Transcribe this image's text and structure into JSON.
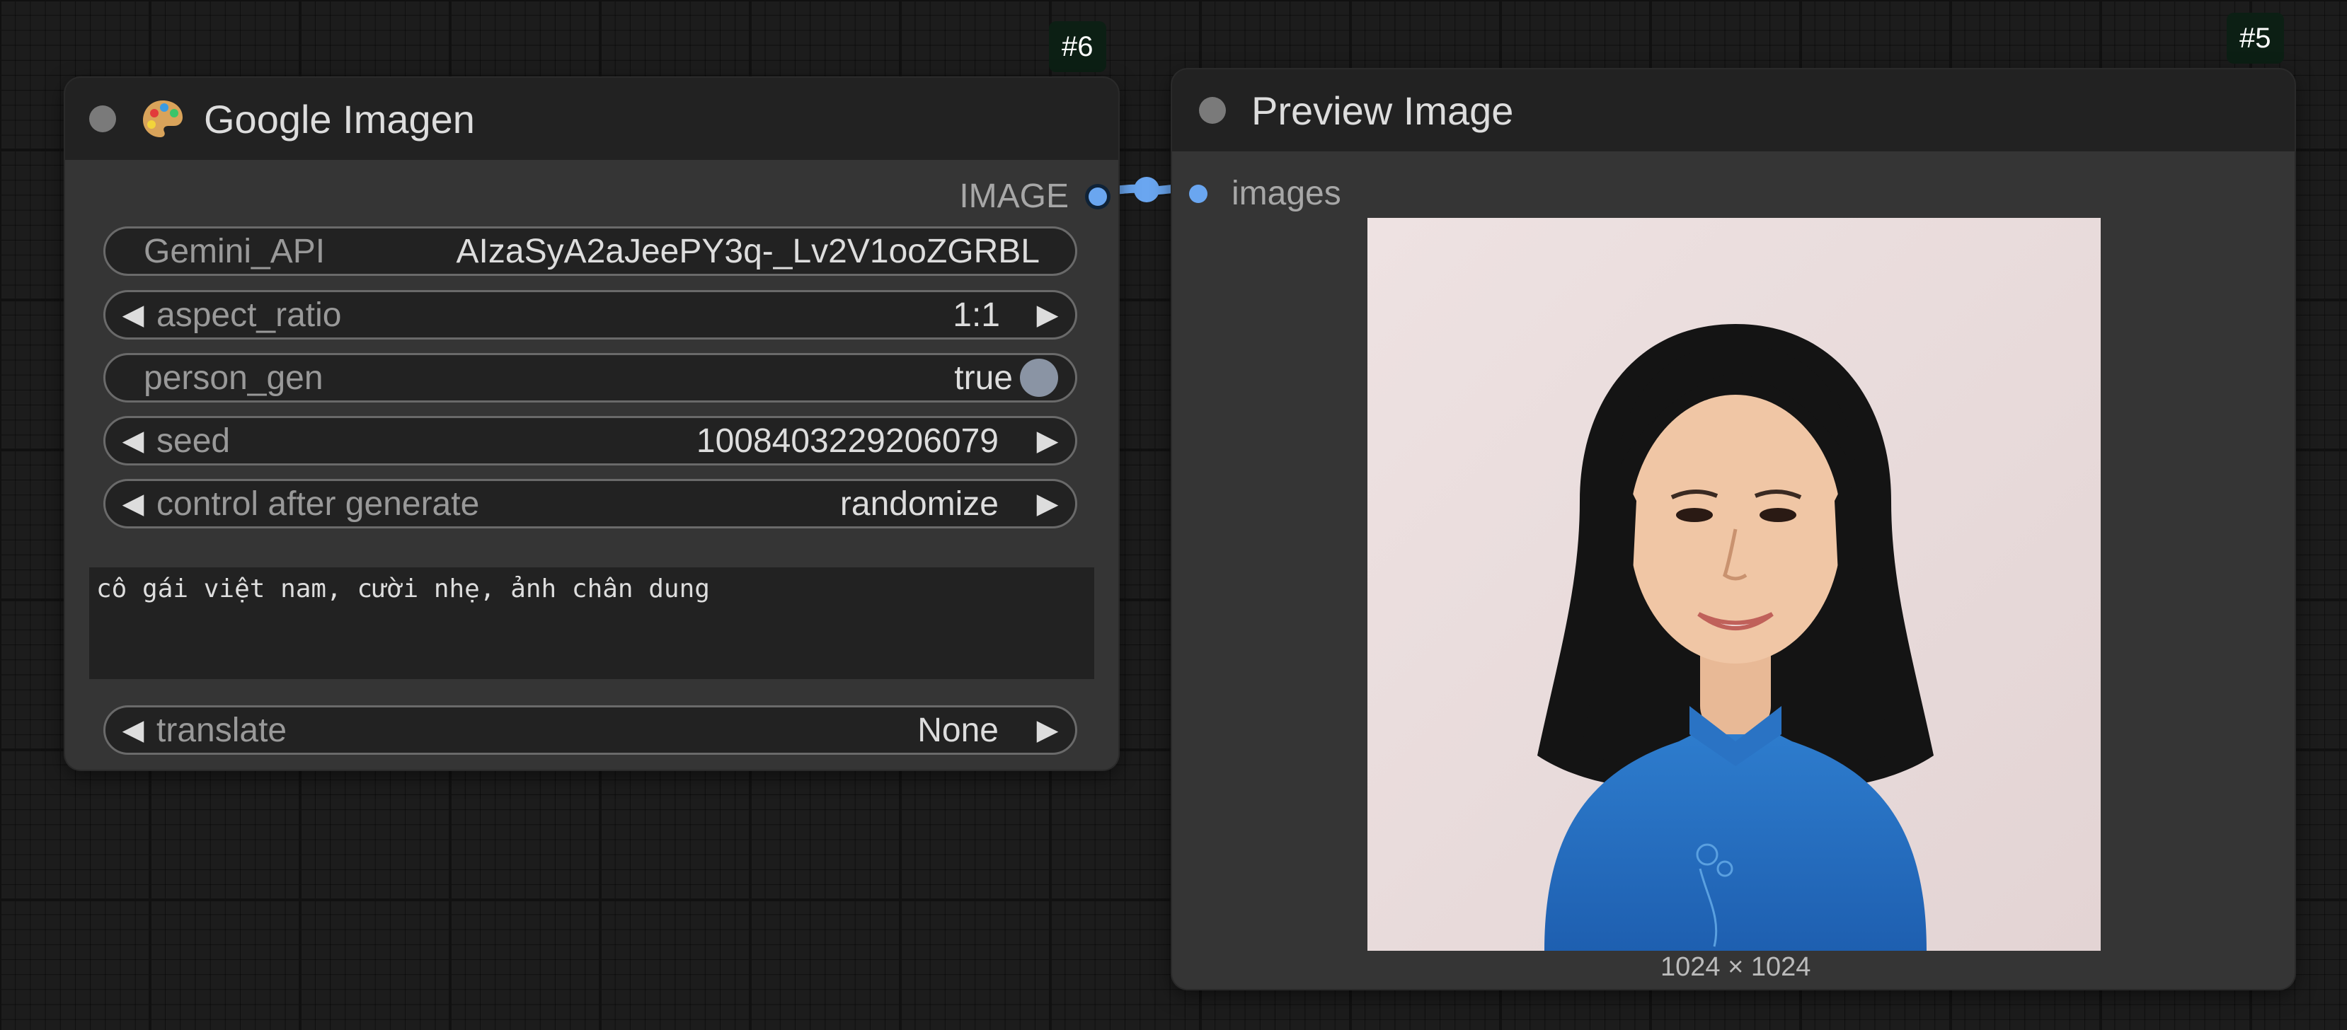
{
  "node_google": {
    "id_badge": "#6",
    "title": "Google Imagen",
    "icon": "palette-icon",
    "output_label": "IMAGE",
    "widgets": {
      "gemini_api": {
        "label": "Gemini_API",
        "value": "AIzaSyA2aJeePY3q-_Lv2V1ooZGRBL"
      },
      "aspect_ratio": {
        "label": "aspect_ratio",
        "value": "1:1"
      },
      "person_gen": {
        "label": "person_gen",
        "value": "true"
      },
      "seed": {
        "label": "seed",
        "value": "1008403229206079"
      },
      "control_after_generate": {
        "label": "control after generate",
        "value": "randomize"
      },
      "prompt": {
        "value": "cô gái việt nam, cười nhẹ, ảnh chân dung"
      },
      "translate": {
        "label": "translate",
        "value": "None"
      }
    }
  },
  "node_preview": {
    "id_badge": "#5",
    "title": "Preview Image",
    "input_label": "images",
    "image_caption": "1024 × 1024"
  },
  "colors": {
    "link": "#6aa6f0",
    "node_bg": "#353535",
    "header_bg": "#222222",
    "widget_bg": "#222222",
    "badge_bg": "#0c1f14"
  }
}
